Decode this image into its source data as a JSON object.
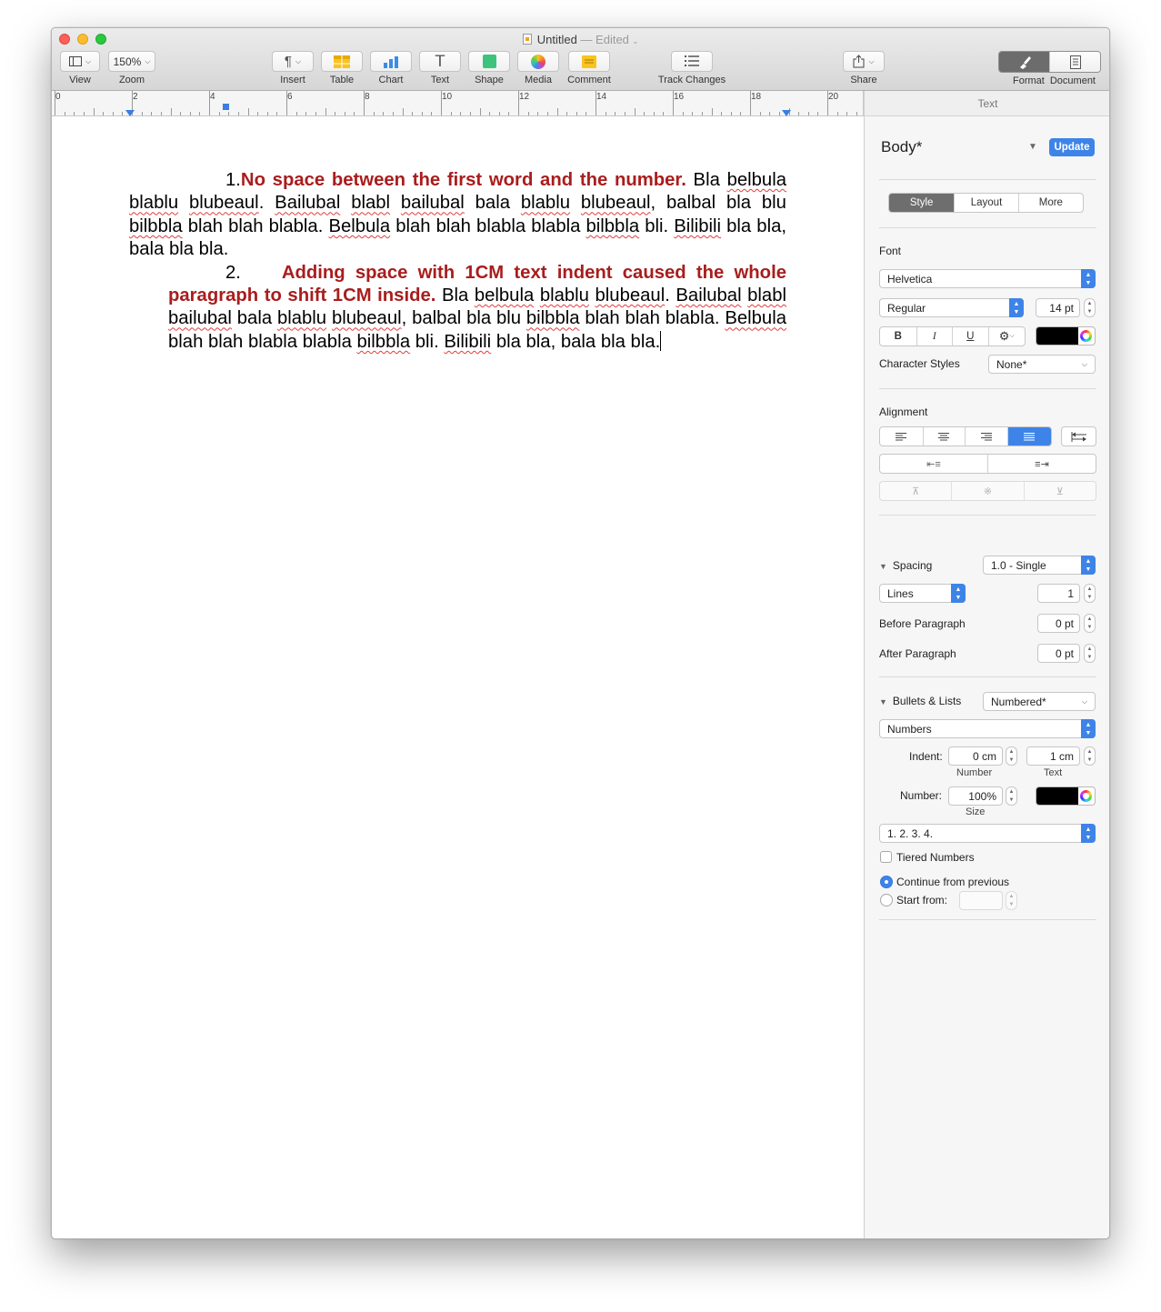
{
  "window": {
    "title": "Untitled",
    "title_status": "— Edited"
  },
  "toolbar": {
    "view_label": "View",
    "zoom_value": "150%",
    "zoom_label": "Zoom",
    "insert_label": "Insert",
    "table_label": "Table",
    "chart_label": "Chart",
    "text_label": "Text",
    "shape_label": "Shape",
    "media_label": "Media",
    "comment_label": "Comment",
    "track_changes_label": "Track Changes",
    "share_label": "Share",
    "format_label": "Format",
    "document_label": "Document"
  },
  "ruler": {
    "numbers": [
      "0",
      "2",
      "4",
      "6",
      "8",
      "10",
      "12",
      "14",
      "16",
      "18",
      "20"
    ]
  },
  "document": {
    "para1": {
      "number": "1.",
      "red_text": "No space between the first word and the number.",
      "body": [
        {
          "t": " Bla ",
          "sq": false
        },
        {
          "t": "belbula",
          "sq": true
        },
        {
          "t": " ",
          "sq": false
        },
        {
          "t": "blablu",
          "sq": true
        },
        {
          "t": " ",
          "sq": false
        },
        {
          "t": "blubeaul",
          "sq": true
        },
        {
          "t": ". ",
          "sq": false
        },
        {
          "t": "Bailubal",
          "sq": true
        },
        {
          "t": " ",
          "sq": false
        },
        {
          "t": "blabl",
          "sq": true
        },
        {
          "t": " ",
          "sq": false
        },
        {
          "t": "bailubal",
          "sq": true
        },
        {
          "t": " bala ",
          "sq": false
        },
        {
          "t": "blablu",
          "sq": true
        },
        {
          "t": " ",
          "sq": false
        },
        {
          "t": "blubeaul",
          "sq": true
        },
        {
          "t": ", balbal bla blu ",
          "sq": false
        },
        {
          "t": "bilbbla",
          "sq": true
        },
        {
          "t": " blah blah blabla. ",
          "sq": false
        },
        {
          "t": "Belbula",
          "sq": true
        },
        {
          "t": " blah blah blabla blabla ",
          "sq": false
        },
        {
          "t": "bilbbla",
          "sq": true
        },
        {
          "t": " bli. ",
          "sq": false
        },
        {
          "t": "Bilibili",
          "sq": true
        },
        {
          "t": " bla bla, bala bla bla.",
          "sq": false
        }
      ]
    },
    "para2": {
      "number": "2.",
      "red_text": "Adding space with 1CM text indent caused the whole paragraph to shift 1CM inside.",
      "body": [
        {
          "t": " Bla ",
          "sq": false
        },
        {
          "t": "belbula",
          "sq": true
        },
        {
          "t": " ",
          "sq": false
        },
        {
          "t": "blablu",
          "sq": true
        },
        {
          "t": " ",
          "sq": false
        },
        {
          "t": "blubeaul",
          "sq": true
        },
        {
          "t": ". ",
          "sq": false
        },
        {
          "t": "Bailubal",
          "sq": true
        },
        {
          "t": " ",
          "sq": false
        },
        {
          "t": "blabl",
          "sq": true
        },
        {
          "t": " ",
          "sq": false
        },
        {
          "t": "bailubal",
          "sq": true
        },
        {
          "t": " bala ",
          "sq": false
        },
        {
          "t": "blablu",
          "sq": true
        },
        {
          "t": " ",
          "sq": false
        },
        {
          "t": "blubeaul",
          "sq": true
        },
        {
          "t": ", balbal bla blu ",
          "sq": false
        },
        {
          "t": "bilbbla",
          "sq": true
        },
        {
          "t": " blah blah blabla. ",
          "sq": false
        },
        {
          "t": "Belbula",
          "sq": true
        },
        {
          "t": " blah blah blabla blabla ",
          "sq": false
        },
        {
          "t": "bilbbla",
          "sq": true
        },
        {
          "t": " bli. ",
          "sq": false
        },
        {
          "t": "Bilibili",
          "sq": true
        },
        {
          "t": " bla bla, bala bla bla.",
          "sq": false
        }
      ]
    }
  },
  "inspector": {
    "header": "Text",
    "style_name": "Body*",
    "update_label": "Update",
    "tabs": [
      "Style",
      "Layout",
      "More"
    ],
    "font_label": "Font",
    "font_family": "Helvetica",
    "font_typeface": "Regular",
    "font_size": "14 pt",
    "bold_label": "B",
    "italic_label": "I",
    "underline_label": "U",
    "text_color": "#000000",
    "character_styles_label": "Character Styles",
    "character_style_value": "None*",
    "alignment_label": "Alignment",
    "spacing_label": "Spacing",
    "spacing_value": "1.0 - Single",
    "lines_value": "Lines",
    "lines_count": "1",
    "before_paragraph_label": "Before Paragraph",
    "before_paragraph_value": "0 pt",
    "after_paragraph_label": "After Paragraph",
    "after_paragraph_value": "0 pt",
    "bullets_label": "Bullets & Lists",
    "bullets_value": "Numbered*",
    "list_type": "Numbers",
    "indent_label": "Indent:",
    "indent_number_value": "0 cm",
    "indent_text_value": "1 cm",
    "indent_number_caption": "Number",
    "indent_text_caption": "Text",
    "number_label": "Number:",
    "number_size_value": "100%",
    "number_size_caption": "Size",
    "number_color": "#000000",
    "number_format": "1. 2. 3. 4.",
    "tiered_numbers_label": "Tiered Numbers",
    "continue_label": "Continue from previous",
    "start_from_label": "Start from:",
    "accent_color": "#3e84e8"
  }
}
